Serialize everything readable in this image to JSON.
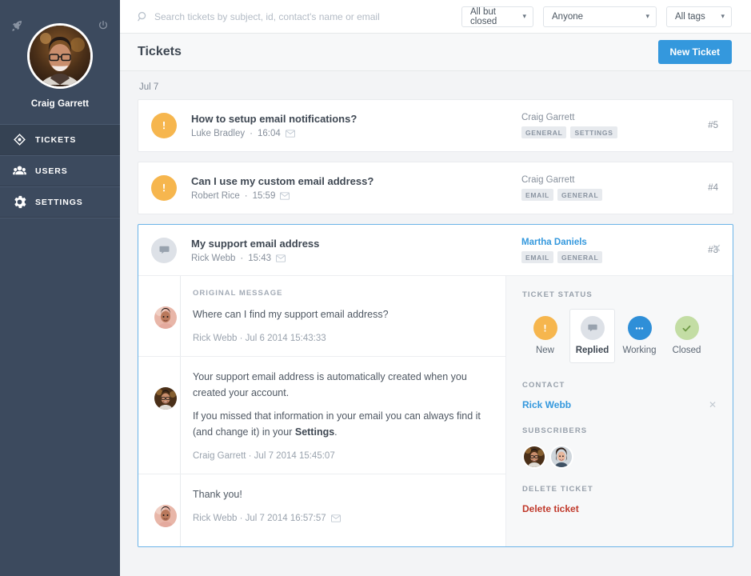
{
  "sidebar": {
    "brand_icon": "rocket-icon",
    "power_icon": "power-icon",
    "user_name": "Craig Garrett",
    "items": [
      {
        "label": "TICKETS",
        "icon": "ticket-icon",
        "active": true
      },
      {
        "label": "USERS",
        "icon": "users-icon",
        "active": false
      },
      {
        "label": "SETTINGS",
        "icon": "gear-icon",
        "active": false
      }
    ]
  },
  "topbar": {
    "search_placeholder": "Search tickets by subject, id, contact's name or email",
    "search_value": "",
    "search_icon": "search-icon",
    "filters": [
      {
        "name": "status-filter",
        "value": "All but closed"
      },
      {
        "name": "assignee-filter",
        "value": "Anyone"
      },
      {
        "name": "tags-filter",
        "value": "All tags"
      }
    ]
  },
  "page": {
    "title": "Tickets",
    "new_ticket_label": "New Ticket",
    "date_group": "Jul 7"
  },
  "tickets": [
    {
      "status": "new",
      "status_icon": "exclamation-icon",
      "subject": "How to setup email notifications?",
      "author": "Luke Bradley",
      "time": "16:04",
      "has_email_icon": true,
      "assignee": "Craig Garrett",
      "assignee_highlight": false,
      "tags": [
        "GENERAL",
        "SETTINGS"
      ],
      "number": "#5"
    },
    {
      "status": "new",
      "status_icon": "exclamation-icon",
      "subject": "Can I use my custom email address?",
      "author": "Robert Rice",
      "time": "15:59",
      "has_email_icon": true,
      "assignee": "Craig Garrett",
      "assignee_highlight": false,
      "tags": [
        "EMAIL",
        "GENERAL"
      ],
      "number": "#4"
    }
  ],
  "expanded_ticket": {
    "status": "replied",
    "status_icon": "speech-bubble-icon",
    "subject": "My support email address",
    "author": "Rick Webb",
    "time": "15:43",
    "has_email_icon": true,
    "assignee": "Martha Daniels",
    "assignee_highlight": true,
    "tags": [
      "EMAIL",
      "GENERAL"
    ],
    "number": "#3",
    "close_icon": "close-icon",
    "messages": [
      {
        "label": "ORIGINAL MESSAGE",
        "avatar": "rick-webb-avatar",
        "paragraphs": [
          {
            "text": "Where can I find my support email address?",
            "bold_part": ""
          }
        ],
        "footer": "Rick Webb · Jul 6 2014 15:43:33",
        "has_email_icon": false
      },
      {
        "label": "",
        "avatar": "craig-garrett-avatar",
        "paragraphs": [
          {
            "text": "Your support email address is automatically created when you created your account.",
            "bold_part": ""
          },
          {
            "text_before": "If you missed that information in your email you can always find it (and change it) in your ",
            "bold_part": "Settings",
            "text_after": "."
          }
        ],
        "footer": "Craig Garrett · Jul 7 2014 15:45:07",
        "has_email_icon": false
      },
      {
        "label": "",
        "avatar": "rick-webb-avatar",
        "paragraphs": [
          {
            "text": "Thank you!",
            "bold_part": ""
          }
        ],
        "footer": "Rick Webb · Jul 7 2014 16:57:57",
        "has_email_icon": true
      }
    ],
    "detail_panel": {
      "status_label": "TICKET STATUS",
      "statuses": [
        {
          "name": "New",
          "icon": "exclamation-icon",
          "selected": false
        },
        {
          "name": "Replied",
          "icon": "speech-bubble-icon",
          "selected": true
        },
        {
          "name": "Working",
          "icon": "ellipsis-icon",
          "selected": false
        },
        {
          "name": "Closed",
          "icon": "check-icon",
          "selected": false
        }
      ],
      "contact_label": "CONTACT",
      "contact_name": "Rick Webb",
      "contact_remove_icon": "close-icon",
      "subscribers_label": "SUBSCRIBERS",
      "subscribers": [
        "craig-garrett-avatar",
        "martha-daniels-avatar"
      ],
      "delete_label": "DELETE TICKET",
      "delete_link": "Delete ticket"
    }
  },
  "colors": {
    "sidebar_bg": "#3c4a5e",
    "accent_blue": "#3498dd",
    "status_new": "#f6b64e",
    "status_replied": "#dde1e7",
    "status_working": "#2f8fd8",
    "status_closed": "#c3dda4",
    "danger": "#c0392b"
  }
}
